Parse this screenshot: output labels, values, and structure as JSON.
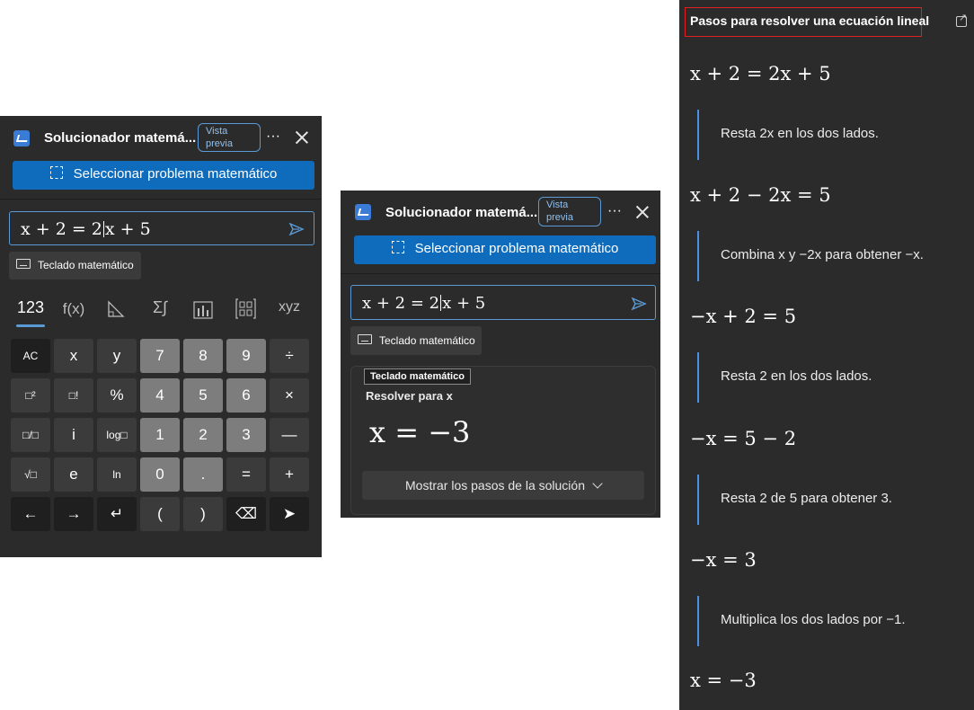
{
  "panel1": {
    "app_title": "Solucionador matemá...",
    "badge": "Vista previa",
    "badge_line1": "Vista",
    "badge_line2": "previa",
    "more": "···",
    "select_button": "Seleccionar problema matemático",
    "input_pre": "x + 2 = 2",
    "input_post": "x + 5",
    "keyboard_button": "Teclado matemático",
    "tabs": [
      "123",
      "f(x)",
      "△",
      "Σ∫",
      "📊",
      "⊞",
      "xyz"
    ],
    "keys": [
      [
        "AC",
        "x",
        "y",
        "7",
        "8",
        "9",
        "÷"
      ],
      [
        "□²",
        "□!",
        "%",
        "4",
        "5",
        "6",
        "×"
      ],
      [
        "□/□",
        "i",
        "log□",
        "1",
        "2",
        "3",
        "—"
      ],
      [
        "√□",
        "e",
        "ln",
        "0",
        ".",
        "=",
        "+"
      ],
      [
        "←",
        "→",
        "↵",
        "(",
        ")",
        "⌫",
        "➤"
      ]
    ]
  },
  "panel2": {
    "app_title": "Solucionador matemá...",
    "badge_line1": "Vista",
    "badge_line2": "previa",
    "more": "···",
    "select_button": "Seleccionar problema matemático",
    "input_pre": "x + 2 = 2",
    "input_post": "x + 5",
    "keyboard_button": "Teclado matemático",
    "tooltip": "Teclado matemático",
    "solve_label": "Resolver para x",
    "result": "x = −3",
    "show_steps": "Mostrar los pasos de la solución"
  },
  "steps_panel": {
    "title": "Pasos para resolver una ecuación lineal",
    "steps": [
      {
        "eq": "x + 2 = 2x + 5",
        "text": "Resta 2x en los dos lados."
      },
      {
        "eq": "x + 2 − 2x = 5",
        "text": "Combina x y −2x para obtener −x."
      },
      {
        "eq": "−x + 2 = 5",
        "text": "Resta 2 en los dos lados."
      },
      {
        "eq": "−x = 5 − 2",
        "text": "Resta 2 de 5 para obtener 3."
      },
      {
        "eq": "−x = 3",
        "text": "Multiplica los dos lados por −1."
      },
      {
        "eq": "x = −3",
        "text": ""
      }
    ]
  },
  "colors": {
    "panel_bg": "#2b2b2b",
    "accent": "#0f6cbd",
    "focus_border": "#5b9bd5",
    "title_highlight": "#e02020"
  }
}
